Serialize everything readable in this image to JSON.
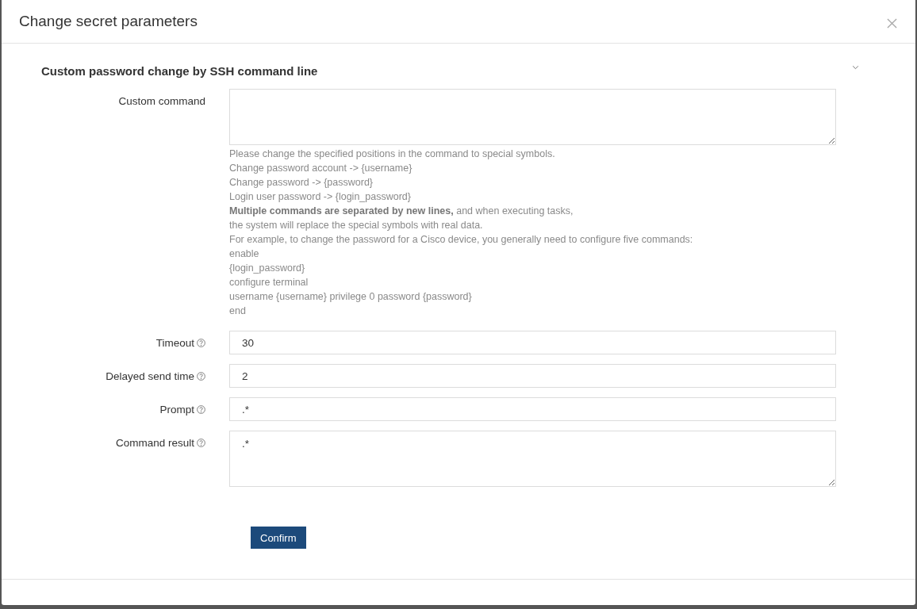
{
  "dialog": {
    "title": "Change secret parameters"
  },
  "section": {
    "title": "Custom password change by SSH command line",
    "expanded": true
  },
  "fields": [
    {
      "kind": "textarea",
      "label": "Custom command",
      "has_help": false,
      "help_lines": [
        "Please change the specified positions in the command to special symbols.",
        "Change password account -> {username}",
        "Change password -> {password}",
        "Login user password -> {login_password}",
        "**Multiple commands are separated by new lines,** and when executing tasks,",
        "the system will replace the special symbols with real data.",
        "For example, to change the password for a Cisco device, you generally need to configure five commands:",
        "enable",
        "{login_password}",
        "configure terminal",
        "username {username} privilege 0 password {password}",
        "end"
      ]
    },
    {
      "kind": "text",
      "label": "Timeout",
      "has_help": true,
      "value": "30"
    },
    {
      "kind": "text",
      "label": "Delayed send time",
      "has_help": true,
      "value": "2"
    },
    {
      "kind": "text",
      "label": "Prompt",
      "has_help": true,
      "value": ".*"
    },
    {
      "kind": "textarea",
      "label": "Command result",
      "has_help": true,
      "value": ".*"
    }
  ],
  "buttons": [
    {
      "label": "Confirm",
      "kind": "primary"
    }
  ]
}
